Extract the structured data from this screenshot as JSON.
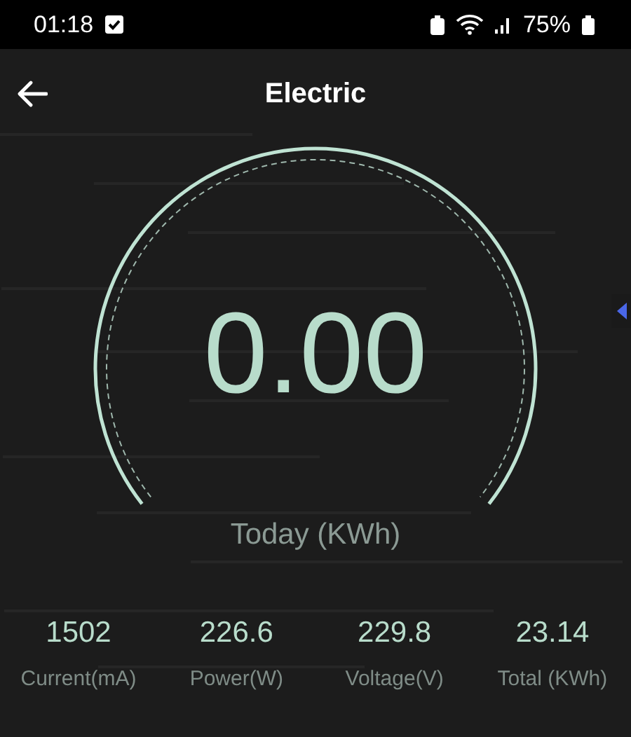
{
  "status_bar": {
    "time": "01:18",
    "battery": "75%"
  },
  "header": {
    "title": "Electric"
  },
  "gauge": {
    "value": "0.00",
    "label": "Today (KWh)"
  },
  "stats": [
    {
      "value": "1502",
      "label": "Current(mA)"
    },
    {
      "value": "226.6",
      "label": "Power(W)"
    },
    {
      "value": "229.8",
      "label": "Voltage(V)"
    },
    {
      "value": "23.14",
      "label": "Total (KWh)"
    }
  ]
}
